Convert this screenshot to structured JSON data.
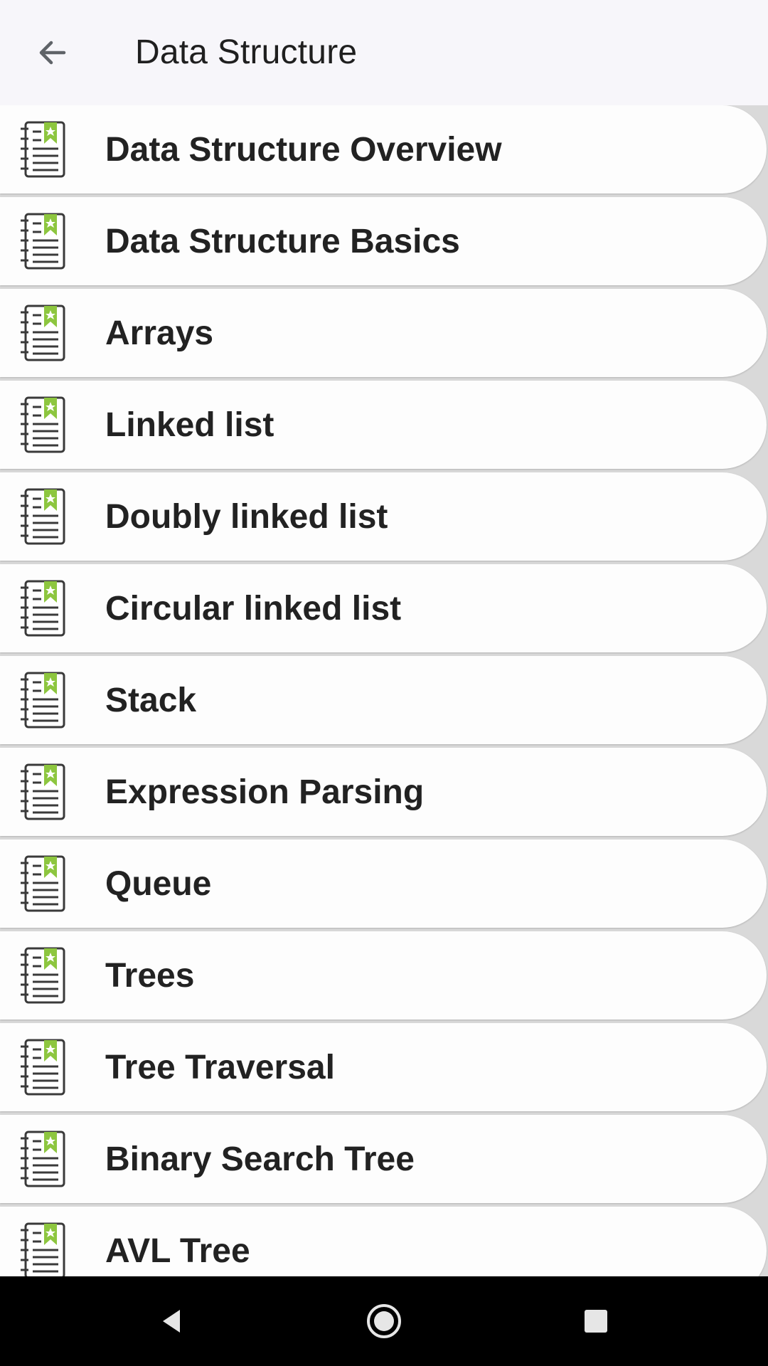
{
  "app_bar": {
    "title": "Data Structure",
    "back_icon": "arrow-back-icon"
  },
  "list": {
    "item_icon": "notebook-bookmark-icon",
    "icon_accent": "#8dc63f",
    "items": [
      {
        "label": "Data Structure Overview"
      },
      {
        "label": "Data Structure Basics"
      },
      {
        "label": "Arrays"
      },
      {
        "label": "Linked list"
      },
      {
        "label": "Doubly linked list"
      },
      {
        "label": "Circular linked list"
      },
      {
        "label": "Stack"
      },
      {
        "label": "Expression Parsing"
      },
      {
        "label": "Queue"
      },
      {
        "label": "Trees"
      },
      {
        "label": "Tree Traversal"
      },
      {
        "label": "Binary Search Tree"
      },
      {
        "label": "AVL Tree"
      }
    ]
  },
  "nav_bar": {
    "back_icon": "nav-back-icon",
    "home_icon": "nav-home-icon",
    "recents_icon": "nav-recents-icon"
  }
}
